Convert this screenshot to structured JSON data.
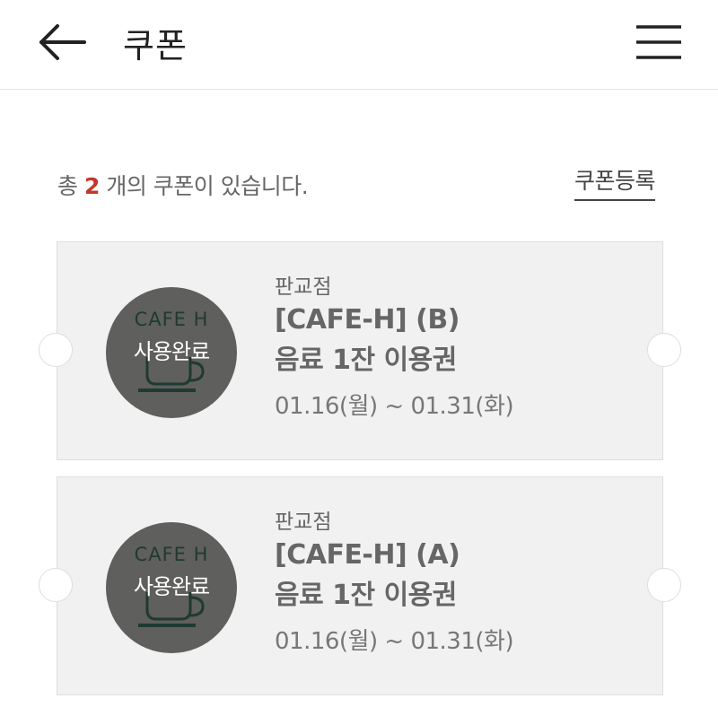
{
  "header": {
    "title": "쿠폰",
    "back_icon": "arrow-left-icon",
    "menu_icon": "hamburger-menu-icon"
  },
  "summary": {
    "prefix": "총",
    "count": "2",
    "suffix": "개의 쿠폰이 있습니다.",
    "register_label": "쿠폰등록"
  },
  "colors": {
    "accent": "#c0392b",
    "badge": "#5f5f5d",
    "card": "#f1f1f1",
    "brand_logo": "#1f3a32"
  },
  "coupons": [
    {
      "store": "판교점",
      "title_line1": "[CAFE-H] (B)",
      "title_line2": "음료 1잔 이용권",
      "period": "01.16(월) ~ 01.31(화)",
      "brand": "CAFE H",
      "status": "사용완료"
    },
    {
      "store": "판교점",
      "title_line1": "[CAFE-H] (A)",
      "title_line2": "음료 1잔 이용권",
      "period": "01.16(월) ~ 01.31(화)",
      "brand": "CAFE H",
      "status": "사용완료"
    }
  ]
}
